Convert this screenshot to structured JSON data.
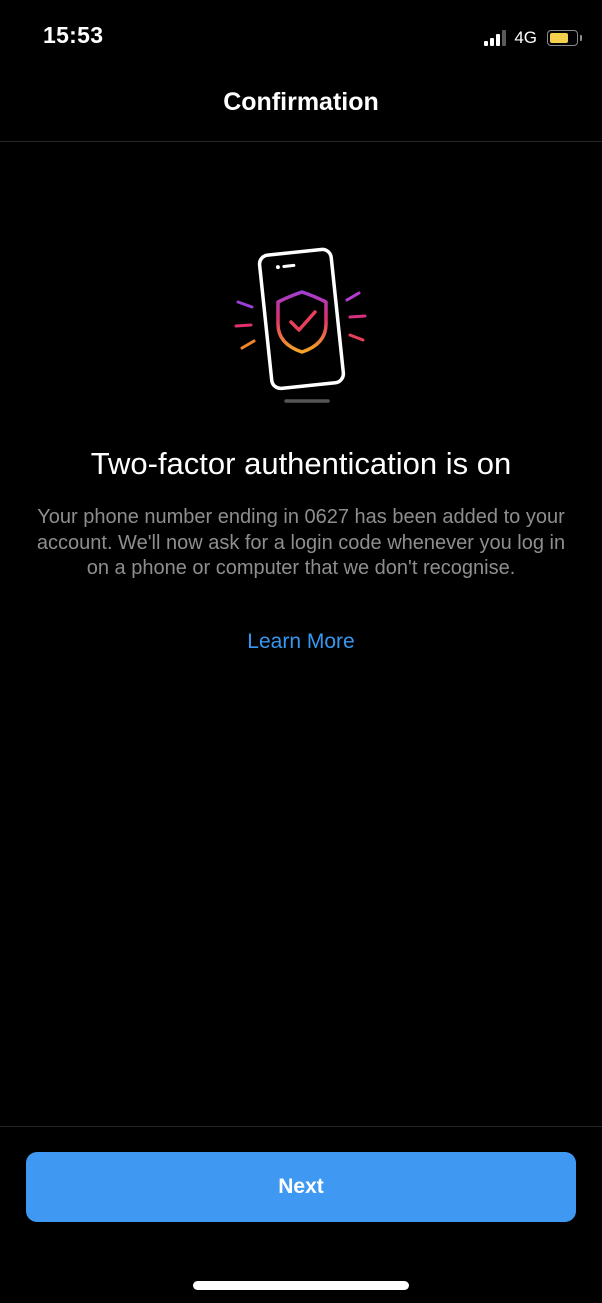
{
  "status_bar": {
    "time": "15:53",
    "network": "4G",
    "battery_level": 0.75,
    "battery_color": "#f5d04c"
  },
  "nav": {
    "title": "Confirmation"
  },
  "illustration": {
    "icon": "phone-shield-check-icon"
  },
  "content": {
    "headline": "Two-factor authentication is on",
    "body": "Your phone number ending in 0627 has been added to your account. We'll now ask for a login code whenever you log in on a phone or computer that we don't recognise.",
    "learn_more": "Learn More"
  },
  "footer": {
    "next_label": "Next"
  },
  "colors": {
    "background": "#000000",
    "accent": "#3f98f2",
    "link": "#3797f0",
    "secondary_text": "#8e8e8e"
  }
}
